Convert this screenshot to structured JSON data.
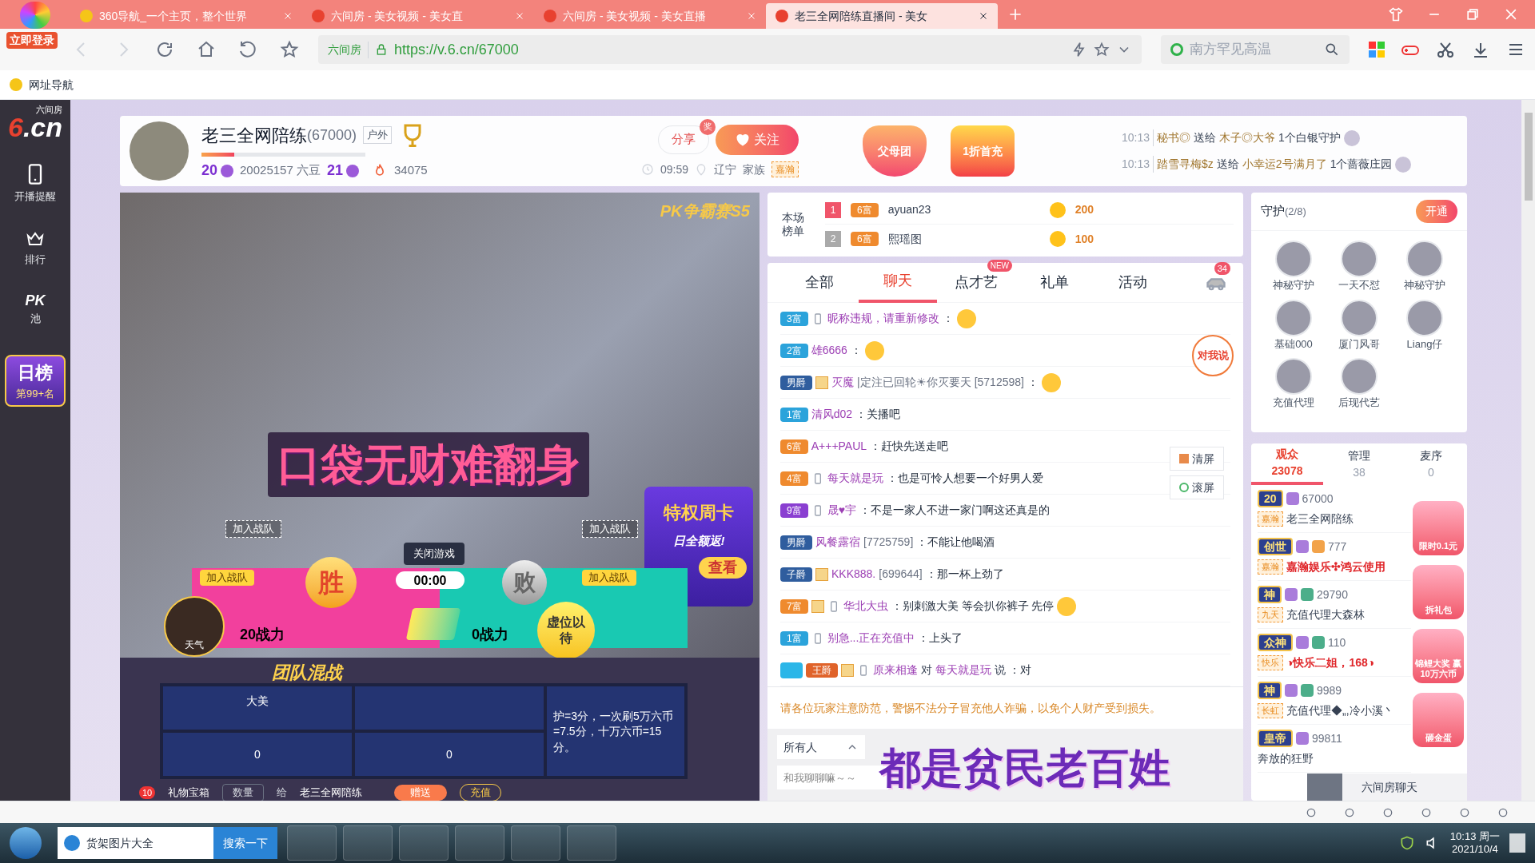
{
  "browser": {
    "login_button": "立即登录",
    "tabs": [
      {
        "title": "360导航_一个主页，整个世界",
        "selected": false
      },
      {
        "title": "六间房 - 美女视频 - 美女直",
        "selected": false
      },
      {
        "title": "六间房 - 美女视频 - 美女直播",
        "selected": false
      },
      {
        "title": "老三全网陪练直播间 - 美女",
        "selected": true
      }
    ],
    "site_badge": "六间房",
    "url": "https://v.6.cn/67000",
    "search_placeholder": "南方罕见高温",
    "bookmarks": [
      "网址导航"
    ]
  },
  "sidebar": {
    "logo_top": "六间房",
    "logo": "6.cn",
    "items": [
      {
        "kind": "phone",
        "label": "开播提醒"
      },
      {
        "kind": "crown",
        "label": "排行"
      },
      {
        "kind": "pk",
        "badge": "PK",
        "label": "池"
      }
    ],
    "daily_rank": {
      "title": "日榜",
      "rank": "第99+名"
    }
  },
  "host": {
    "name": "老三全网陪练",
    "room_id": "(67000)",
    "tag": "户外",
    "level": 0.2,
    "wealth_level": "20",
    "beans": "20025157 六豆",
    "star_level": "21",
    "fire": "34075",
    "share": "分享",
    "share_badge": "奖",
    "follow": "关注",
    "time": "09:59",
    "location": "辽宁",
    "family_label": "家族",
    "family": "嘉瀚"
  },
  "promos": [
    "父母团",
    "1折首充"
  ],
  "gift_feed": [
    {
      "time": "10:13",
      "sender": "秘书◎",
      "verb": "送给",
      "receiver": "木子◎大爷",
      "gift": "1个白银守护"
    },
    {
      "time": "10:13",
      "sender": "踏雪寻梅$z",
      "verb": "送给",
      "receiver": "小幸运2号满月了",
      "gift": "1个蔷薇庄园"
    }
  ],
  "video": {
    "event": "PK争霸赛S5",
    "join_labels": [
      "加入战队",
      "加入战队",
      "加入战队",
      "加入战队"
    ],
    "close_game": "关闭游戏",
    "timer": "00:00",
    "win": "胜",
    "lose": "败",
    "left_power": "20战力",
    "right_power": "0战力",
    "avatar_label": "天气",
    "vacant": "虚位以待",
    "card_title": "特权周卡",
    "card_sub": "日全额返!",
    "card_button": "查看",
    "team_logo": "团队混战",
    "team_cells": [
      "大美",
      "0",
      "0"
    ],
    "rules": "护=3分，一次刷5万六币=7.5分，十万六币=15分。",
    "gift_count": "10",
    "gift_box": "礼物宝箱",
    "quantity": "数量",
    "to_label": "给",
    "to_name": "老三全网陪练",
    "send": "赠送",
    "recharge": "充值"
  },
  "rank_board": {
    "title": "本场榜单",
    "rows": [
      {
        "rank": "1",
        "badge": "6富",
        "name": "ayuan23",
        "score": "200"
      },
      {
        "rank": "2",
        "badge": "6富",
        "name": "熙瑶图",
        "score": "100"
      }
    ]
  },
  "chat": {
    "tabs": [
      {
        "label": "全部",
        "selected": false
      },
      {
        "label": "聊天",
        "selected": true
      },
      {
        "label": "点才艺",
        "selected": false,
        "badge": "NEW"
      },
      {
        "label": "礼单",
        "selected": false
      },
      {
        "label": "活动",
        "selected": false
      }
    ],
    "car_count": "34",
    "talk_to_me": "对我说",
    "side_buttons": [
      "清屏",
      "滚屏"
    ],
    "messages": [
      {
        "badge": "3富",
        "color": "#2ba3db",
        "phone": true,
        "avatar": false,
        "name": "昵称违规，请重新修改",
        "text": "：",
        "emoji": true
      },
      {
        "badge": "2富",
        "color": "#2ba3db",
        "phone": false,
        "avatar": false,
        "name": "雄6666",
        "text": "：",
        "emoji": true
      },
      {
        "badge": "男爵",
        "color": "#2f5d9e",
        "phone": false,
        "avatar": true,
        "name": "灭魔",
        "sign": "|定注已回轮☀你灭要天",
        "uid": "[5712598]",
        "text": "：",
        "emoji": true
      },
      {
        "badge": "1富",
        "color": "#2ba3db",
        "phone": false,
        "avatar": false,
        "name": "清风d02",
        "text": "：关播吧",
        "emoji": false
      },
      {
        "badge": "6富",
        "color": "#ef8a2e",
        "phone": false,
        "avatar": false,
        "name": "A+++PAUL",
        "text": "：赶快先送走吧",
        "emoji": false
      },
      {
        "badge": "4富",
        "color": "#ef8a2e",
        "phone": true,
        "avatar": false,
        "name": "每天就是玩",
        "text": "：也是可怜人想要一个好男人爱",
        "emoji": false
      },
      {
        "badge": "9富",
        "color": "#8a3fd1",
        "phone": true,
        "avatar": false,
        "name": "晟♥宇",
        "text": "：不是一家人不进一家门啊这还真是的",
        "emoji": false
      },
      {
        "badge": "男爵",
        "color": "#2f5d9e",
        "phone": false,
        "avatar": false,
        "name": "风餐露宿",
        "uid": "[7725759]",
        "text": "：不能让他喝酒",
        "emoji": false
      },
      {
        "badge": "子爵",
        "color": "#2f5d9e",
        "phone": false,
        "avatar": true,
        "name": "KKK888.",
        "uid": "[699644]",
        "text": "：那一杯上劲了",
        "emoji": false
      },
      {
        "badge": "7富",
        "color": "#ef8a2e",
        "phone": true,
        "avatar": true,
        "name": "华北大虫",
        "text": "：别刺激大美 等会扒你裤子 先停",
        "emoji": true
      },
      {
        "badge": "1富",
        "color": "#2ba3db",
        "phone": true,
        "avatar": false,
        "name": "别急...正在充值中",
        "text": "：上头了",
        "emoji": false
      },
      {
        "badge": "王爵",
        "color": "#e0632a",
        "vip": true,
        "phone": true,
        "avatar": true,
        "name": "原来相逢",
        "to_word": "对",
        "target": "每天就是玩",
        "say_word": "说",
        "text": "：对",
        "emoji": false
      }
    ],
    "notice": "请各位玩家注意防范，警惕不法分子冒充他人诈骗，以免个人财产受到损失。",
    "recipient": "所有人",
    "input_placeholder": "和我聊聊嘛～～"
  },
  "guard": {
    "title": "守护",
    "count": "(2/8)",
    "open_button": "开通",
    "members": [
      "神秘守护",
      "一天不怼",
      "神秘守护",
      "基础000",
      "厦门风哥",
      "Liang仔",
      "充值代理",
      "后现代艺"
    ]
  },
  "audience": {
    "tabs": [
      {
        "label": "观众",
        "count": "23078",
        "selected": true
      },
      {
        "label": "管理",
        "count": "38",
        "selected": false
      },
      {
        "label": "麦序",
        "count": "0",
        "selected": false
      }
    ],
    "users": [
      {
        "title": "20",
        "k": false,
        "guard": false,
        "uid": "67000",
        "family": "嘉瀚",
        "name": "老三全网陪练",
        "highlight": false
      },
      {
        "title": "创世",
        "k": false,
        "guard": true,
        "uid": "777",
        "family": "嘉瀚",
        "name": "嘉瀚娱乐✣鸿云使用",
        "highlight": true
      },
      {
        "title": "神",
        "k": true,
        "guard": false,
        "uid": "29790",
        "family": "九天",
        "name": "充值代理大森林",
        "highlight": false
      },
      {
        "title": "众神",
        "k": true,
        "guard": false,
        "uid": "110",
        "family": "快乐",
        "name": "◑快乐二姐，168◑",
        "highlight": true
      },
      {
        "title": "神",
        "k": true,
        "guard": false,
        "uid": "9989",
        "family": "长虹",
        "name": "充值代理◆„,冷小溪丶",
        "highlight": false
      },
      {
        "title": "皇帝",
        "k": false,
        "guard": false,
        "uid": "99811",
        "name": "奔放的狂野",
        "highlight": false
      }
    ],
    "side_promos": [
      "限时0.1元",
      "拆礼包",
      "锦鲤大奖 赢10万六币",
      "砸金蛋"
    ],
    "chat_button": "六间房聊天"
  },
  "captions": [
    "口袋无财难翻身",
    "都是贫民老百姓"
  ],
  "taskbar": {
    "search_value": "货架图片大全",
    "search_button": "搜索一下",
    "time": "10:13 周一",
    "date": "2021/10/4"
  }
}
